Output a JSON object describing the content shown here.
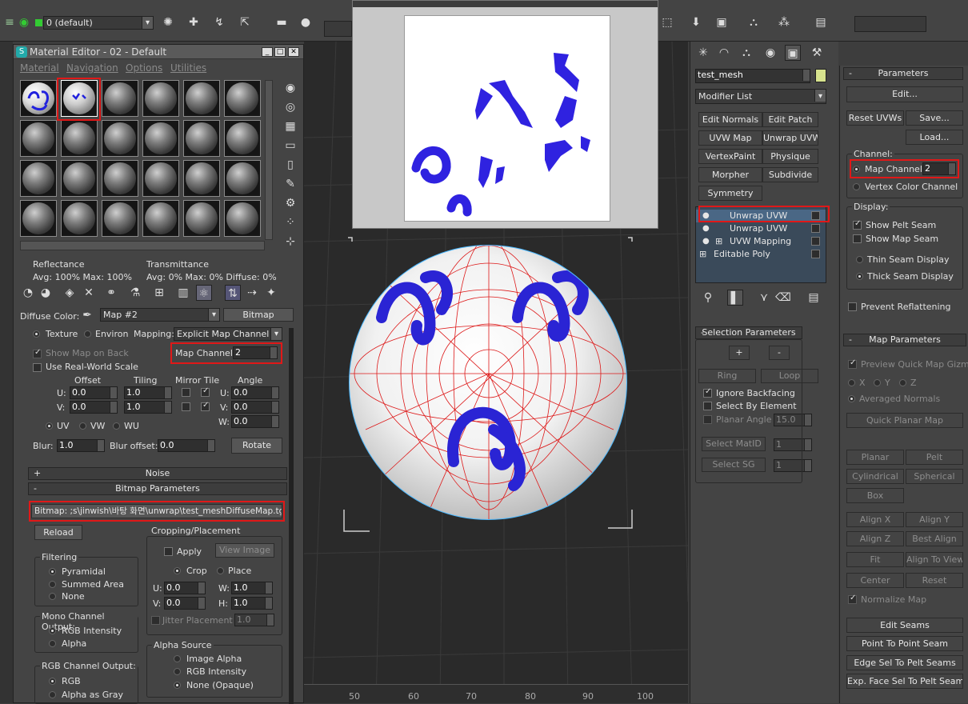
{
  "toolbar": {
    "layer_dropdown": "0 (default)"
  },
  "mat_editor": {
    "title": "Material Editor - 02 - Default",
    "menu": [
      "Material",
      "Navigation",
      "Options",
      "Utilities"
    ],
    "reflectance_title": "Reflectance",
    "reflectance_values": "Avg: 100% Max: 100%",
    "transmittance_title": "Transmittance",
    "transmittance_values": "Avg:   0% Max:   0% Diffuse:   0%",
    "diffuse_color_label": "Diffuse Color:",
    "diffuse_map_name": "Map #2",
    "diffuse_map_type": "Bitmap",
    "coords": {
      "texture": "Texture",
      "environ": "Environ",
      "mapping_label": "Mapping:",
      "mapping_value": "Explicit Map Channel",
      "show_map_on_back": "Show Map on Back",
      "map_channel_label": "Map Channel:",
      "map_channel_value": "2",
      "use_real_world": "Use Real-World Scale",
      "offset": "Offset",
      "tiling": "Tiling",
      "mirror_tile": "Mirror Tile",
      "angle": "Angle",
      "u": "U:",
      "v": "V:",
      "w": "W:",
      "u_offset": "0.0",
      "v_offset": "0.0",
      "u_tiling": "1.0",
      "v_tiling": "1.0",
      "u_angle": "0.0",
      "v_angle": "0.0",
      "w_angle": "0.0",
      "uv": "UV",
      "vw": "VW",
      "wu": "WU",
      "blur_label": "Blur:",
      "blur_value": "1.0",
      "blur_offset_label": "Blur offset:",
      "blur_offset_value": "0.0",
      "rotate": "Rotate"
    },
    "noise_rollout": "Noise",
    "bitmap_rollout": "Bitmap Parameters",
    "bitmap_path": "Bitmap: ;s\\jinwish\\바탕 화면\\unwrap\\test_meshDiffuseMap.tga",
    "reload": "Reload",
    "cropping": {
      "title": "Cropping/Placement",
      "apply": "Apply",
      "view_image": "View Image",
      "crop": "Crop",
      "place": "Place",
      "u": "U:",
      "v": "V:",
      "w": "W:",
      "h": "H:",
      "u_val": "0.0",
      "v_val": "0.0",
      "w_val": "1.0",
      "h_val": "1.0",
      "jitter": "Jitter Placement",
      "jitter_val": "1.0"
    },
    "filtering": {
      "title": "Filtering",
      "pyramidal": "Pyramidal",
      "summed_area": "Summed Area",
      "none": "None"
    },
    "mono_output": {
      "title": "Mono Channel Output:",
      "rgb_intensity": "RGB Intensity",
      "alpha": "Alpha"
    },
    "rgb_output": {
      "title": "RGB Channel Output:",
      "rgb": "RGB",
      "alpha_as_gray": "Alpha as Gray"
    },
    "alpha_source": {
      "title": "Alpha Source",
      "image_alpha": "Image Alpha",
      "rgb_intensity": "RGB Intensity",
      "none": "None (Opaque)"
    }
  },
  "viewport": {
    "ruler": [
      "50",
      "60",
      "70",
      "80",
      "90",
      "100"
    ]
  },
  "command_panel": {
    "object_name": "test_mesh",
    "modifier_list": "Modifier List",
    "mod_buttons": [
      "Edit Normals",
      "Edit Patch",
      "UVW Map",
      "Unwrap UVW",
      "VertexPaint",
      "Physique",
      "Morpher",
      "Subdivide",
      "Symmetry"
    ],
    "stack": [
      "Unwrap UVW",
      "Unwrap UVW",
      "UVW Mapping",
      "Editable Poly"
    ],
    "selection": {
      "title": "Selection Parameters",
      "plus": "+",
      "minus": "-",
      "ring": "Ring",
      "loop": "Loop",
      "ignore_backfacing": "Ignore Backfacing",
      "select_by_element": "Select By Element",
      "planar_angle": "Planar Angle",
      "planar_angle_val": "15.0",
      "select_matid": "Select MatID",
      "select_matid_val": "1",
      "select_sg": "Select SG",
      "select_sg_val": "1"
    }
  },
  "params": {
    "title": "Parameters",
    "edit": "Edit...",
    "reset_uvws": "Reset UVWs",
    "save": "Save...",
    "load": "Load...",
    "channel_title": "Channel:",
    "map_channel_label": "Map Channel:",
    "map_channel_value": "2",
    "vertex_color": "Vertex Color Channel",
    "display_title": "Display:",
    "show_pelt_seam": "Show Pelt Seam",
    "show_map_seam": "Show Map Seam",
    "thin_seam": "Thin Seam Display",
    "thick_seam": "Thick Seam Display",
    "prevent_reflattening": "Prevent Reflattening"
  },
  "map_params": {
    "title": "Map Parameters",
    "preview_gizmo": "Preview Quick Map Gizmo",
    "x": "X",
    "y": "Y",
    "z": "Z",
    "averaged_normals": "Averaged Normals",
    "quick_planar": "Quick Planar Map",
    "planar": "Planar",
    "pelt": "Pelt",
    "cylindrical": "Cylindrical",
    "spherical": "Spherical",
    "box": "Box",
    "align_x": "Align X",
    "align_y": "Align Y",
    "align_z": "Align Z",
    "best_align": "Best Align",
    "fit": "Fit",
    "align_to_view": "Align To View",
    "center": "Center",
    "reset": "Reset",
    "normalize_map": "Normalize Map",
    "edit_seams": "Edit Seams",
    "point_to_point": "Point To Point Seam",
    "edge_sel": "Edge Sel To Pelt Seams",
    "exp_face_sel": "Exp. Face Sel To Pelt Seams"
  },
  "colors": {
    "highlight": "#e01818",
    "stack_active": "#4a6785",
    "uv_blue": "#2222dd"
  }
}
